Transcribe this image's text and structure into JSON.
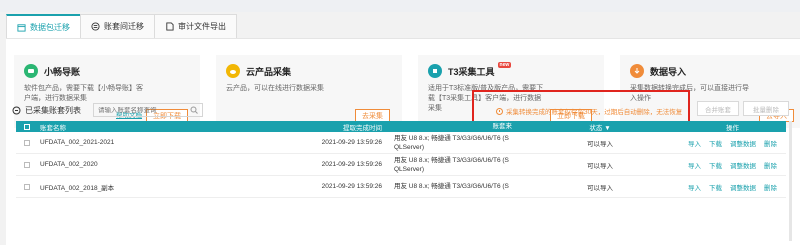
{
  "tabs": [
    {
      "label": "数据包迁移"
    },
    {
      "label": "账套间迁移"
    },
    {
      "label": "审计文件导出"
    }
  ],
  "cards": [
    {
      "title": "小畅导账",
      "desc": "软件包产品，需要下载【小畅导账】客户端，进行数据采集",
      "help": "帮助文档",
      "button": "立即下载",
      "color": "#2bb673"
    },
    {
      "title": "云产品采集",
      "desc": "云产品，可以在线进行数据采集",
      "button": "去采集",
      "color": "#f2b705"
    },
    {
      "title": "T3采集工具",
      "badge": "new",
      "desc": "适用于T3标准版/普及版产品，需要下载【T3采集工具】客户端，进行数据采集",
      "button": "立即下载",
      "color": "#1aa1ad"
    },
    {
      "title": "数据导入",
      "desc": "采集数据转换完成后，可以直接进行导入操作",
      "button": "去导入",
      "color": "#f08c3a"
    }
  ],
  "toolbar": {
    "list_label": "已采集账套列表",
    "search_placeholder": "请输入账套名称查询"
  },
  "warning": "采集转换完成的账套仅保留30天，过期后自动删除，无法恢复",
  "buttons": {
    "merge": "合并账套",
    "batch_delete": "批量删除"
  },
  "table": {
    "headers": [
      "账套名称",
      "提取完成时间",
      "账套来",
      "状态",
      "操作"
    ],
    "rows": [
      {
        "name": "UFDATA_002_2021-2021",
        "time": "2021-09-29 13:59:26",
        "src1": "用友 U8 8.x; 畅捷通 T3/G3/G6/U6/T6 (S",
        "src2": "QLServer)",
        "status": "可以导入",
        "actions": [
          "导入",
          "下载",
          "调整数据",
          "删除"
        ]
      },
      {
        "name": "UFDATA_002_2020",
        "time": "2021-09-29 13:59:26",
        "src1": "用友 U8 8.x; 畅捷通 T3/G3/G6/U6/T6 (S",
        "src2": "QLServer)",
        "status": "可以导入",
        "actions": [
          "导入",
          "下载",
          "调整数据",
          "删除"
        ]
      },
      {
        "name": "UFDATA_002_2018_副本",
        "time": "2021-09-29 13:59:26",
        "src1": "用友 U8 8.x; 畅捷通 T3/G3/G6/U6/T6 (S",
        "src2": "",
        "status": "可以导入",
        "actions": [
          "导入",
          "下载",
          "调整数据",
          "删除"
        ]
      }
    ]
  }
}
